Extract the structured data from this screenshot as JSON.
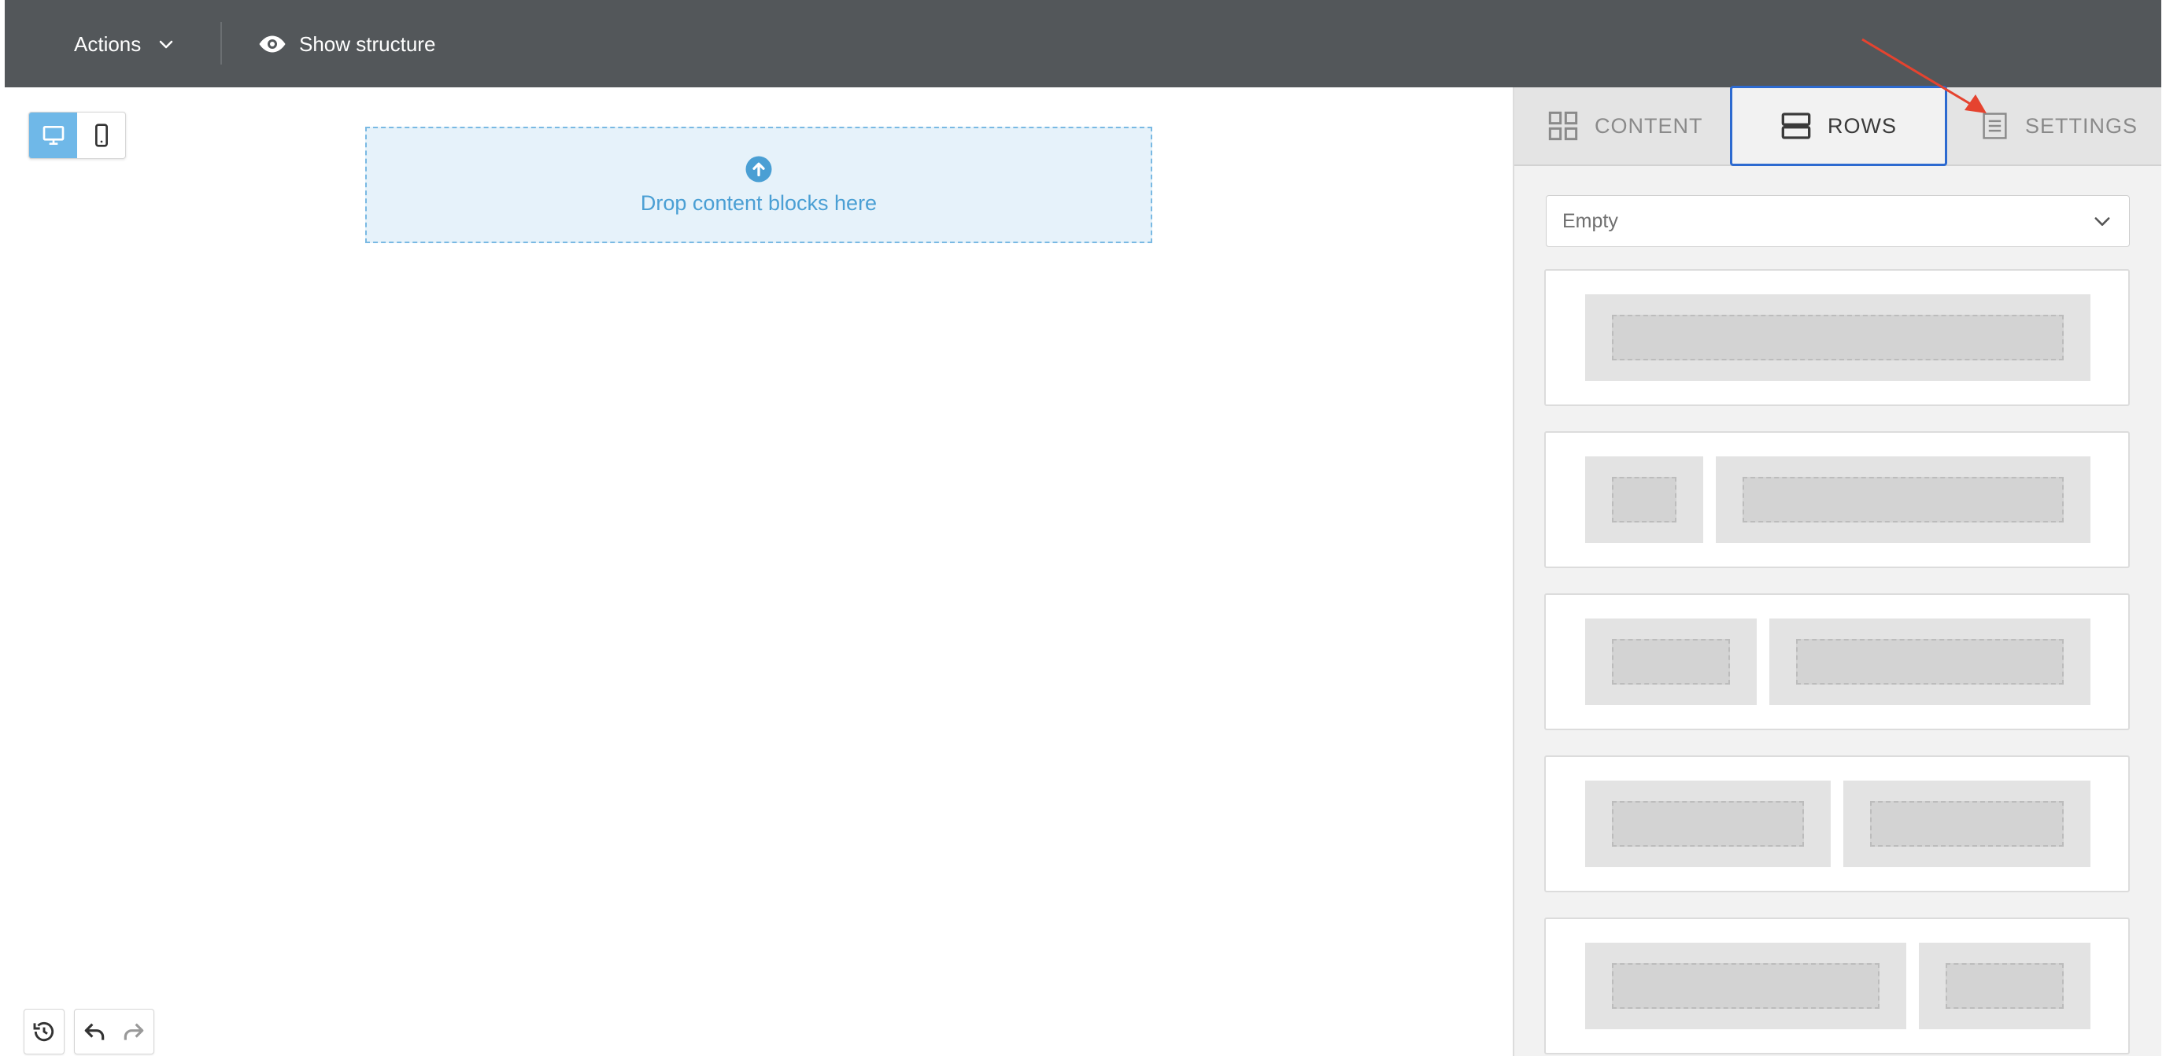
{
  "toolbar": {
    "actions_label": "Actions",
    "show_structure_label": "Show structure",
    "icons": [
      "chevron-down-icon",
      "eye-icon"
    ]
  },
  "device_toggle": {
    "options": [
      "desktop",
      "mobile"
    ],
    "active": "desktop",
    "active_color": "#6fb8e8"
  },
  "canvas": {
    "dropzone_label": "Drop content blocks here",
    "dropzone_icon": "upload-circle-icon",
    "accent": "#4a9fd4"
  },
  "panel": {
    "tabs": [
      {
        "label": "CONTENT",
        "icon": "grid-icon"
      },
      {
        "label": "ROWS",
        "icon": "rows-icon",
        "active": true
      },
      {
        "label": "SETTINGS",
        "icon": "settings-document-icon"
      }
    ],
    "row_filter": {
      "selected": "Empty"
    },
    "row_layouts": [
      {
        "columns": [
          12
        ]
      },
      {
        "columns": [
          3,
          9
        ]
      },
      {
        "columns": [
          4,
          8
        ]
      },
      {
        "columns": [
          6,
          6
        ]
      },
      {
        "columns": [
          8,
          4
        ]
      }
    ],
    "active_tab_border": "#2d6ad0"
  },
  "history": {
    "buttons": [
      "history-icon",
      "undo-icon",
      "redo-icon"
    ]
  },
  "annotation": {
    "arrow_color": "#e5432f"
  }
}
